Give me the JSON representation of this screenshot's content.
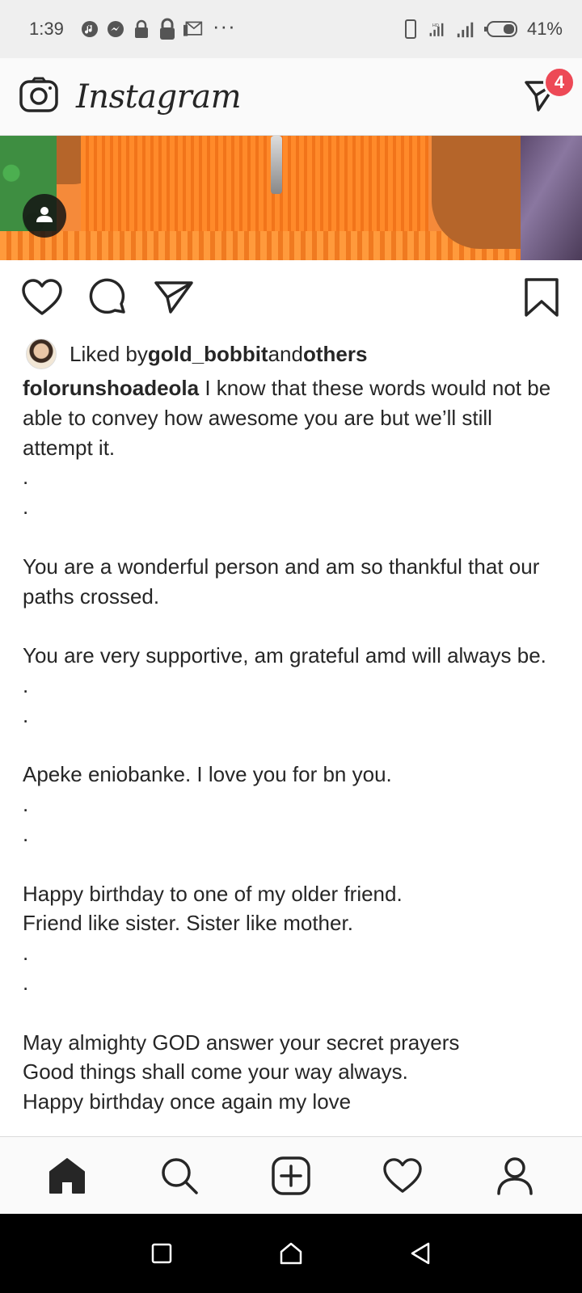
{
  "status_bar": {
    "time": "1:39",
    "battery": "41%",
    "overflow": "···"
  },
  "header": {
    "logo": "Instagram",
    "dm_badge": "4"
  },
  "likes": {
    "prefix": "Liked by ",
    "user": "gold_bobbit",
    "middle": " and ",
    "others": "others"
  },
  "caption": {
    "username": "folorunshoadeola",
    "text": " I know that these words would not be able to convey how awesome you are but we’ll still attempt it.\n.\n.\n\nYou are a wonderful person and am so thankful that our paths crossed.\n\nYou are very supportive, am grateful amd will always be.\n.\n.\n\nApeke eniobanke. I love you for bn you.\n.\n.\n\nHappy birthday to one of my older friend.\nFriend like sister. Sister like mother.\n.\n.\n\nMay almighty GOD answer your secret prayers\nGood things shall come your way always.\nHappy birthday once again my love"
  },
  "icons": {
    "camera": "camera-icon",
    "direct": "direct-message-icon",
    "like": "heart-icon",
    "comment": "comment-icon",
    "share": "share-icon",
    "save": "bookmark-icon",
    "home": "home-icon",
    "search": "search-icon",
    "new_post": "add-post-icon",
    "activity": "activity-heart-icon",
    "profile": "profile-icon"
  },
  "colors": {
    "badge": "#ed4956",
    "text": "#262626"
  }
}
